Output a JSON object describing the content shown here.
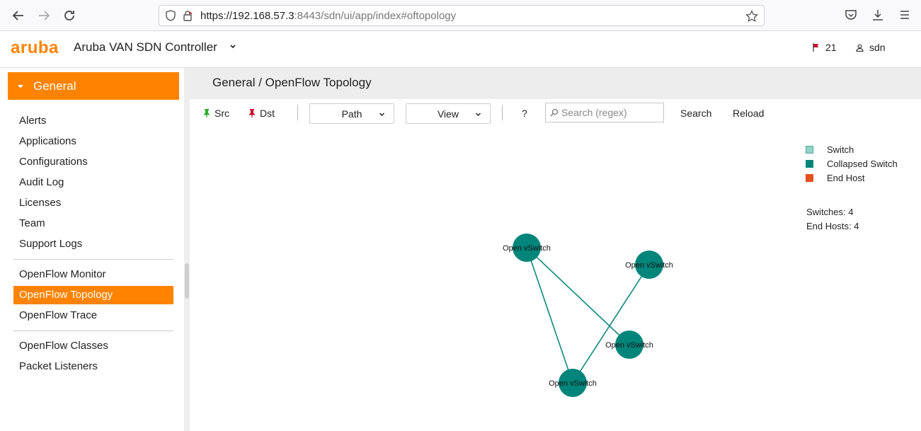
{
  "browser": {
    "url_host": "https://192.168.57.3",
    "url_rest": ":8443/sdn/ui/app/index#oftopology"
  },
  "header": {
    "logo": "aruba",
    "title": "Aruba VAN SDN Controller",
    "alert_count": "21",
    "user": "sdn"
  },
  "sidebar": {
    "section": "General",
    "group1": [
      "Alerts",
      "Applications",
      "Configurations",
      "Audit Log",
      "Licenses",
      "Team",
      "Support Logs"
    ],
    "group2": [
      "OpenFlow Monitor",
      "OpenFlow Topology",
      "OpenFlow Trace"
    ],
    "group3": [
      "OpenFlow Classes",
      "Packet Listeners"
    ]
  },
  "page": {
    "title": "General / OpenFlow Topology"
  },
  "toolbar": {
    "src_label": "Src",
    "dst_label": "Dst",
    "path_label": "Path",
    "view_label": "View",
    "help_label": "?",
    "search_placeholder": "Search (regex)",
    "search_button": "Search",
    "reload_button": "Reload"
  },
  "legend": {
    "switch": "Switch",
    "collapsed_switch": "Collapsed Switch",
    "end_host": "End Host"
  },
  "stats": {
    "switches": "Switches: 4",
    "end_hosts": "End Hosts: 4"
  },
  "topology": {
    "node_label": "Open vSwitch",
    "node_color": "#00857a",
    "link_color": "#0d8a7e"
  },
  "colors": {
    "accent": "#ff8300",
    "switch": "#8fd3c6",
    "collapsed_switch": "#00857a",
    "end_host": "#e5501e",
    "src_pin": "#2fae2f",
    "dst_pin": "#c8102e",
    "alert_flag": "#c8102e"
  }
}
